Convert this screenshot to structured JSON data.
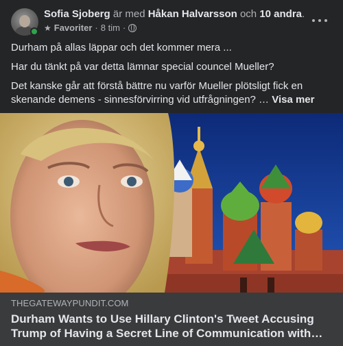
{
  "header": {
    "author": "Sofia Sjoberg",
    "with_text": "är med",
    "tagged": "Håkan Halvarsson",
    "and_text": "och",
    "others": "10 andra",
    "period": ".",
    "audience_label": "Favoriter",
    "time": "8 tim",
    "separator": "·",
    "star_icon": "star-icon",
    "privacy_icon": "globe-icon"
  },
  "post": {
    "paragraphs": [
      "Durham på allas läppar och det kommer mera ...",
      "Har du tänkt på var detta lämnar special councel Mueller?",
      "Det kanske går att förstå bättre nu varför Mueller plötsligt fick en skenande demens - sinnesförvirring vid utfrågningen? …"
    ],
    "see_more": "Visa mer"
  },
  "link": {
    "domain": "THEGATEWAYPUNDIT.COM",
    "title": "Durham Wants to Use Hillary Clinton's Tweet Accusing Trump of Having a Secret Line of Communication with Russia..."
  },
  "colors": {
    "background": "#242526",
    "link_meta_bg": "#3a3b3c",
    "online": "#31a24c",
    "sky": "#123a8a"
  }
}
